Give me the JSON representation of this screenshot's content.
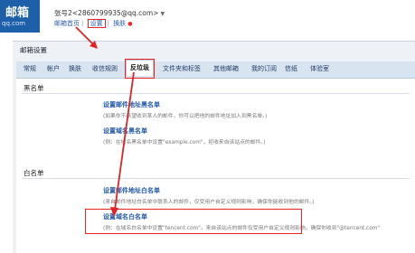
{
  "header": {
    "logo_text": "邮箱",
    "logo_sub": "qq.com",
    "account": "张号2<2860799935@qq.com>",
    "nav": [
      "邮箱首页",
      "设置",
      "换肤"
    ]
  },
  "panel": {
    "title": "邮箱设置",
    "tabs": [
      "常规",
      "帐户",
      "换肤",
      "收信规则",
      "反垃圾",
      "文件夹和标签",
      "其他邮箱",
      "我的订阅",
      "信纸",
      "体验室"
    ],
    "active_tab": "反垃圾"
  },
  "blacklist": {
    "title": "黑名单",
    "address_link": "设置邮件地址黑名单",
    "address_note": "(如果你不希望收到某人的邮件，你可以把他的邮件地址加入到黑名单。)",
    "domain_link": "设置域名黑名单",
    "domain_note": "(例：在域名黑名单中设置\"example.com\"，拒收来自该站点的邮件。)"
  },
  "whitelist": {
    "title": "白名单",
    "address_link": "设置邮件地址白名单",
    "address_note": "(来自邮件地址白名单中联系人的邮件，仅受用户自定义规则影响，确保你能收到他的邮件。)",
    "domain_link": "设置域名白名单",
    "domain_note": "(例：在域名白名单中设置\"tencent.com\"，来自该站点的邮件仅受用户自定义规则影响，确保你收到\"@tencent.com\""
  },
  "colors": {
    "brand": "#1d5fa8",
    "annotation": "#e22222",
    "link": "#1e57b0"
  }
}
